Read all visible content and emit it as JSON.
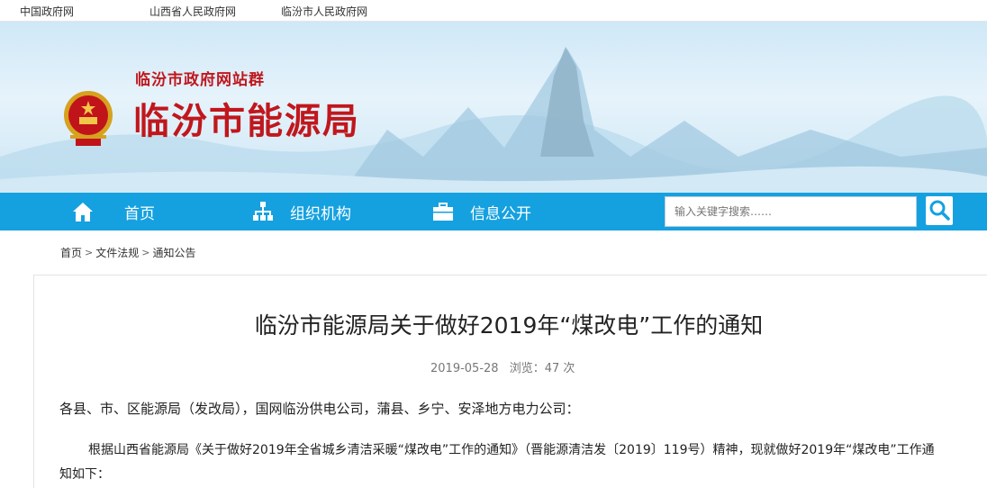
{
  "top_links": [
    "中国政府网",
    "山西省人民政府网",
    "临汾市人民政府网"
  ],
  "banner": {
    "site_group": "临汾市政府网站群",
    "site_title": "临汾市能源局"
  },
  "nav": {
    "home": "首页",
    "org": "组织机构",
    "info": "信息公开"
  },
  "search": {
    "placeholder": "输入关键字搜索……"
  },
  "breadcrumb": [
    "首页",
    "文件法规",
    "通知公告"
  ],
  "article": {
    "title": "临汾市能源局关于做好2019年“煤改电”工作的通知",
    "date": "2019-05-28",
    "views": "浏览：47 次",
    "para1": "各县、市、区能源局（发改局），国网临汾供电公司，蒲县、乡宁、安泽地方电力公司：",
    "para2": "根据山西省能源局《关于做好2019年全省城乡清洁采暖“煤改电”工作的通知》（晋能源清洁发〔2019〕119号）精神，现就做好2019年“煤改电”工作通知如下："
  },
  "colors": {
    "nav": "#15a1e0",
    "title_red": "#c0171d"
  }
}
